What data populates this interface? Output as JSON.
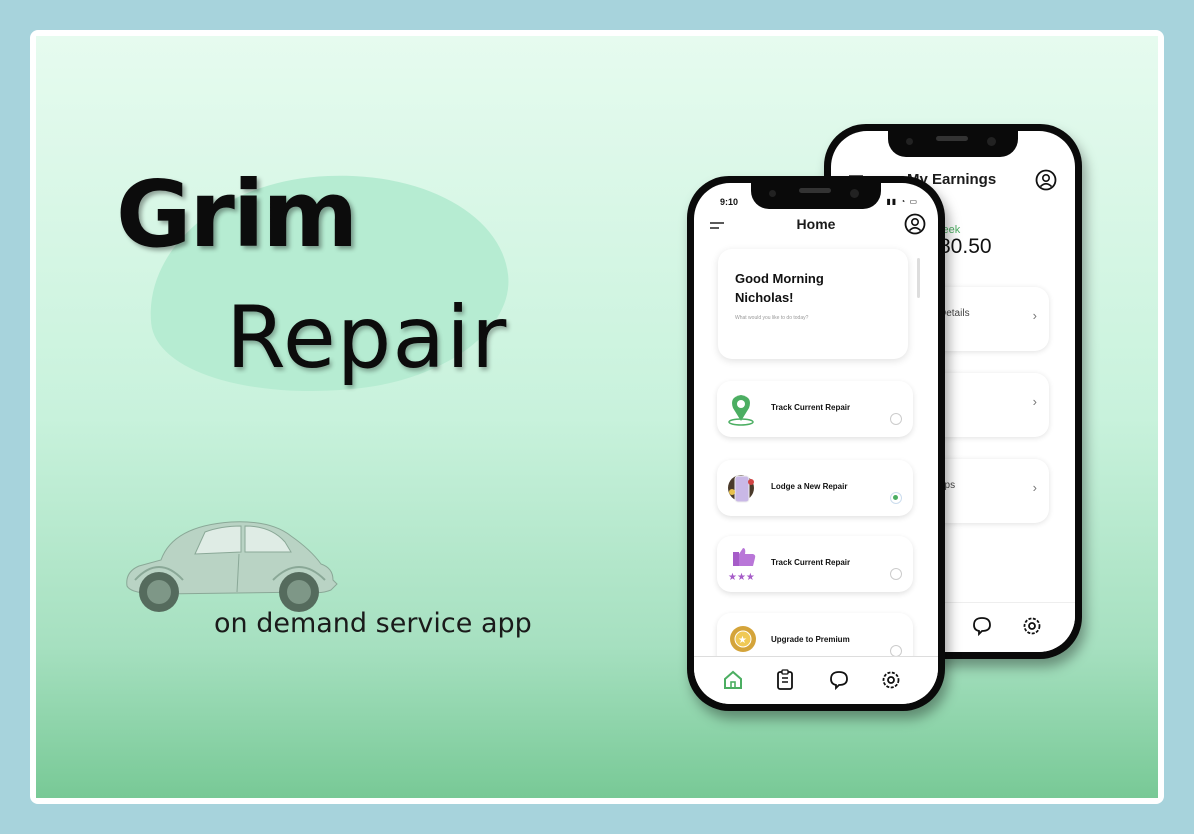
{
  "brand": {
    "title_line1": "Grim",
    "title_line2": "Repair",
    "tagline": "on demand service app"
  },
  "colors": {
    "accent": "#4cae62",
    "background_border": "#a7d3dc",
    "blob": "#b6ecd2"
  },
  "back_screen": {
    "title": "My Earnings",
    "week_label": "s week",
    "amount": "80.50",
    "cards": [
      {
        "label": "Details"
      },
      {
        "label": ""
      },
      {
        "label": "rips"
      }
    ],
    "nav_icons": [
      "chat-icon",
      "settings-icon"
    ]
  },
  "front_screen": {
    "status_time": "9:10",
    "title": "Home",
    "greeting": "Good Morning Nicholas!",
    "greeting_sub": "What would you like to do today?",
    "items": [
      {
        "label": "Track Current Repair",
        "icon": "map-pin-icon",
        "selected": false
      },
      {
        "label": "Lodge a New Repair",
        "icon": "phone-repair-icon",
        "selected": true
      },
      {
        "label": "Track Current Repair",
        "icon": "thumbs-up-rating-icon",
        "selected": false
      },
      {
        "label": "Upgrade to Premium",
        "icon": "premium-badge-icon",
        "selected": false
      }
    ],
    "nav_icons": [
      "home-icon",
      "clipboard-icon",
      "chat-icon",
      "settings-icon"
    ]
  }
}
